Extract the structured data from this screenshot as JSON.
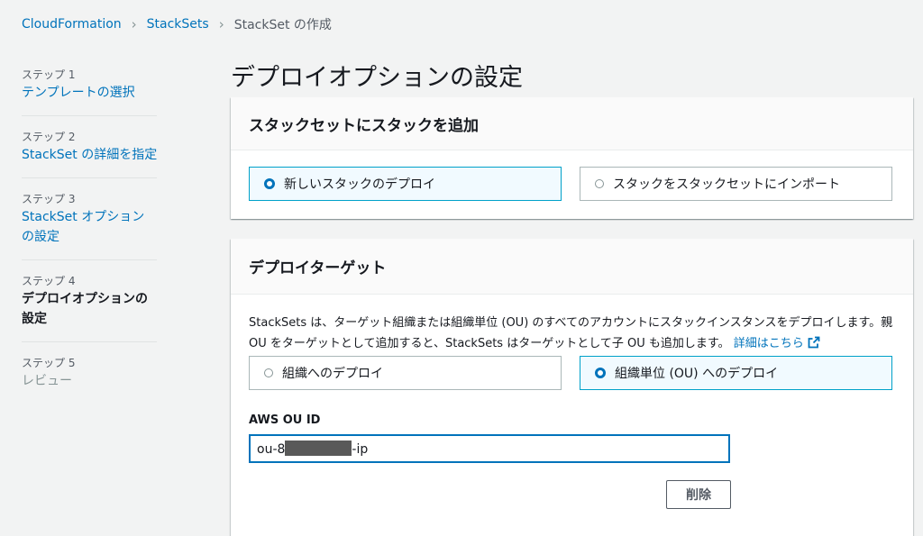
{
  "breadcrumb": {
    "items": [
      "CloudFormation",
      "StackSets"
    ],
    "current": "StackSet の作成"
  },
  "steps": [
    {
      "num": "ステップ 1",
      "label": "テンプレートの選択",
      "state": "link"
    },
    {
      "num": "ステップ 2",
      "label": "StackSet の詳細を指定",
      "state": "link"
    },
    {
      "num": "ステップ 3",
      "label": "StackSet オプションの設定",
      "state": "link"
    },
    {
      "num": "ステップ 4",
      "label": "デプロイオプションの設定",
      "state": "current"
    },
    {
      "num": "ステップ 5",
      "label": "レビュー",
      "state": "disabled"
    }
  ],
  "page_title": "デプロイオプションの設定",
  "add_stacks_panel": {
    "title": "スタックセットにスタックを追加",
    "options": [
      {
        "label": "新しいスタックのデプロイ",
        "selected": true
      },
      {
        "label": "スタックをスタックセットにインポート",
        "selected": false
      }
    ]
  },
  "deploy_target_panel": {
    "title": "デプロイターゲット",
    "description": "StackSets は、ターゲット組織または組織単位 (OU) のすべてのアカウントにスタックインスタンスをデプロイします。親 OU をターゲットとして追加すると、StackSets はターゲットとして子 OU も追加します。",
    "learn_more": "詳細はこちら",
    "options": [
      {
        "label": "組織へのデプロイ",
        "selected": false
      },
      {
        "label": "組織単位 (OU) へのデプロイ",
        "selected": true
      }
    ],
    "ou_label": "AWS OU ID",
    "ou_value_prefix": "ou-8",
    "ou_value_suffix": "-ip",
    "remove_label": "削除"
  },
  "colors": {
    "link": "#0073bb",
    "selected_border": "#00a1c9",
    "selected_bg": "#f1faff",
    "page_bg": "#f2f3f3"
  }
}
